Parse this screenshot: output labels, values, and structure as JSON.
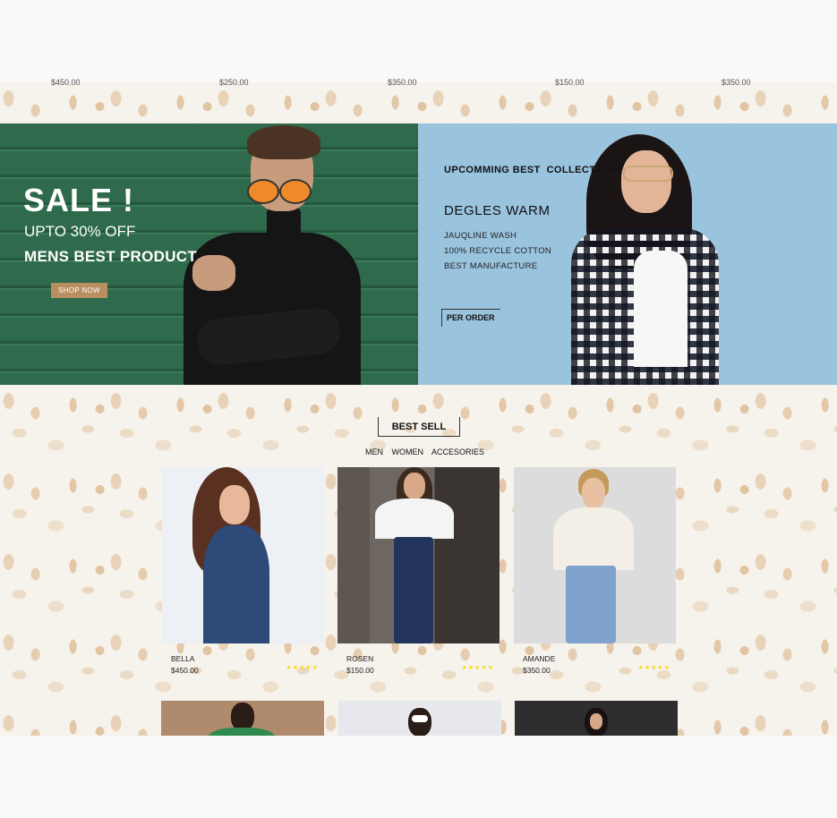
{
  "top_prices": [
    "$450.00",
    "$250.00",
    "$350.00",
    "$150.00",
    "$350.00"
  ],
  "banner_left": {
    "title": "SALE !",
    "subtitle": "UPTO 30% OFF",
    "tagline": "MENS BEST PRODUCT",
    "button_label": "SHOP NOW",
    "bg_color": "#2f6b4c",
    "button_color": "#b98f61"
  },
  "banner_right": {
    "kicker": "UPCOMMING BEST  COLLECTION",
    "title": "DEGLES WARM",
    "features": [
      "JAUQLINE WASH",
      "100% RECYCLE COTTON",
      "BEST MANUFACTURE"
    ],
    "button_label": "PER ORDER",
    "bg_color": "#9ac3de"
  },
  "best_sell": {
    "heading": "BEST SELL",
    "filters": [
      "MEN",
      "WOMEN",
      "ACCESORIES"
    ]
  },
  "products": [
    {
      "name": "BELLA",
      "price": "$450.00",
      "stars": "★★★★★"
    },
    {
      "name": "ROSEN",
      "price": "$150.00",
      "stars": "★★★★★"
    },
    {
      "name": "AMANDE",
      "price": "$350.00",
      "stars": "★★★★★"
    }
  ],
  "colors": {
    "star": "#f2dc1c",
    "accent": "#b98f61"
  }
}
